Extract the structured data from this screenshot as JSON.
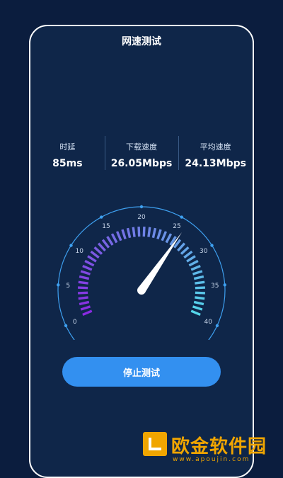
{
  "header": {
    "title": "网速测试"
  },
  "stats": [
    {
      "label": "时延",
      "value": "85ms"
    },
    {
      "label": "下载速度",
      "value": "26.05Mbps"
    },
    {
      "label": "平均速度",
      "value": "24.13Mbps"
    }
  ],
  "gauge": {
    "ticks": [
      "0",
      "5",
      "10",
      "15",
      "20",
      "25",
      "30",
      "35",
      "40"
    ],
    "min": 0,
    "max": 40,
    "current": 26.05,
    "colors": {
      "start": "#8a2be2",
      "end": "#55d6ea",
      "needle": "#ffffff",
      "outer_arc": "#3ea0f0"
    }
  },
  "action": {
    "stop_label": "停止测试"
  },
  "watermark": {
    "brand": "欧金软件园",
    "url": "www.apoujin.com"
  }
}
